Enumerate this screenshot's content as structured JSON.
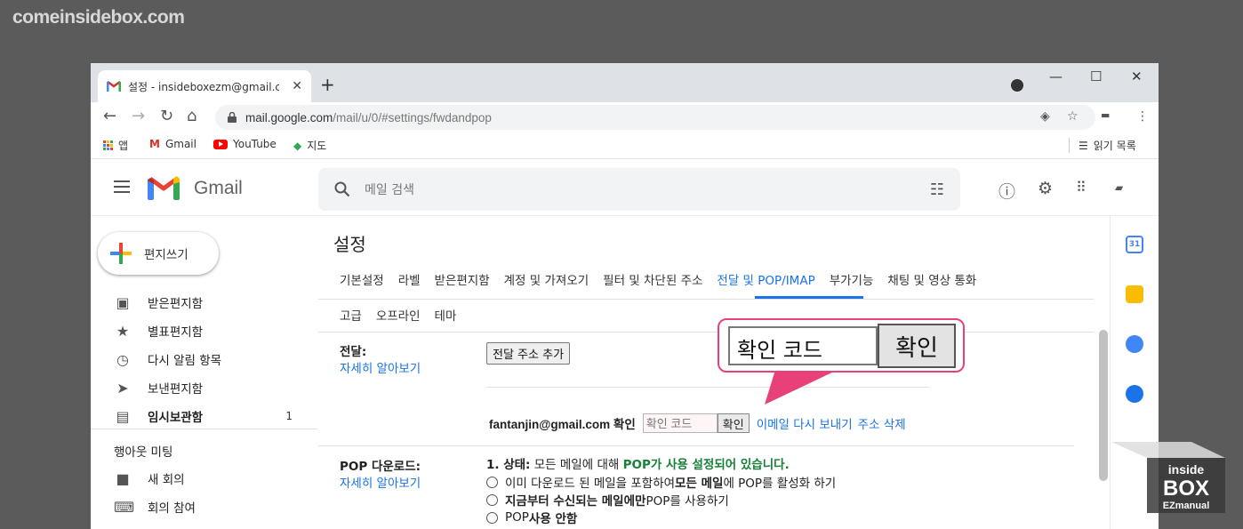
{
  "watermark": "comeinsidebox.com",
  "browser": {
    "tab_title": "설정 - insideboxezm@gmail.com",
    "tab_close": "✕",
    "new_tab": "+",
    "win_min": "—",
    "win_max": "☐",
    "win_close": "✕",
    "url_host": "mail.google.com",
    "url_path": "/mail/u/0/#settings/fwdandpop"
  },
  "bookmarks": {
    "apps": "앱",
    "gmail": "Gmail",
    "youtube": "YouTube",
    "maps": "지도",
    "reading_list": "읽기 목록"
  },
  "gmail": {
    "brand": "Gmail",
    "search_placeholder": "메일 검색"
  },
  "sidebar": {
    "compose": "편지쓰기",
    "items": [
      {
        "label": "받은편지함",
        "icon": "inbox-icon",
        "count": ""
      },
      {
        "label": "별표편지함",
        "icon": "star-icon",
        "count": ""
      },
      {
        "label": "다시 알림 항목",
        "icon": "clock-icon",
        "count": ""
      },
      {
        "label": "보낸편지함",
        "icon": "send-icon",
        "count": ""
      },
      {
        "label": "임시보관함",
        "icon": "draft-icon",
        "count": "1"
      }
    ],
    "meet_title": "행아웃 미팅",
    "meet_items": [
      {
        "label": "새 회의",
        "icon": "video-icon"
      },
      {
        "label": "회의 참여",
        "icon": "keyboard-icon"
      }
    ]
  },
  "settings": {
    "title": "설정",
    "tabs_row1": [
      "기본설정",
      "라벨",
      "받은편지함",
      "계정 및 가져오기",
      "필터 및 차단된 주소",
      "전달 및 POP/IMAP",
      "부가기능",
      "채팅 및 영상 통화"
    ],
    "tabs_row2": [
      "고급",
      "오프라인",
      "테마"
    ],
    "forwarding": {
      "label": "전달:",
      "learn_more": "자세히 알아보기",
      "add_button": "전달 주소 추가",
      "address": "fantanjin@gmail.com 확인",
      "code_placeholder": "확인 코드",
      "confirm": "확인",
      "resend": "이메일 다시 보내기",
      "delete": "주소 삭제"
    },
    "pop": {
      "label": "POP 다운로드:",
      "learn_more": "자세히 알아보기",
      "status_prefix": "1. 상태:",
      "status_mid": " 모든 메일에 대해 ",
      "status_green": "POP가 사용 설정되어 있습니다.",
      "opt1_a": "이미 다운로드 된 메일을 포함하여 ",
      "opt1_b": "모든 메일",
      "opt1_c": "에 POP를 활성화 하기",
      "opt2_a": "지금부터 수신되는 메일에만",
      "opt2_b": " POP를 사용하기",
      "opt3_a": "POP ",
      "opt3_b": "사용 안함"
    }
  },
  "callout": {
    "input_text": "확인 코드",
    "button": "확인"
  },
  "boxmark": {
    "line1": "inside",
    "line2": "BOX",
    "line3": "EZmanual"
  },
  "colors": {
    "accent": "#1a73e8",
    "callout_border": "#e8417a",
    "pop_green": "#188038"
  }
}
